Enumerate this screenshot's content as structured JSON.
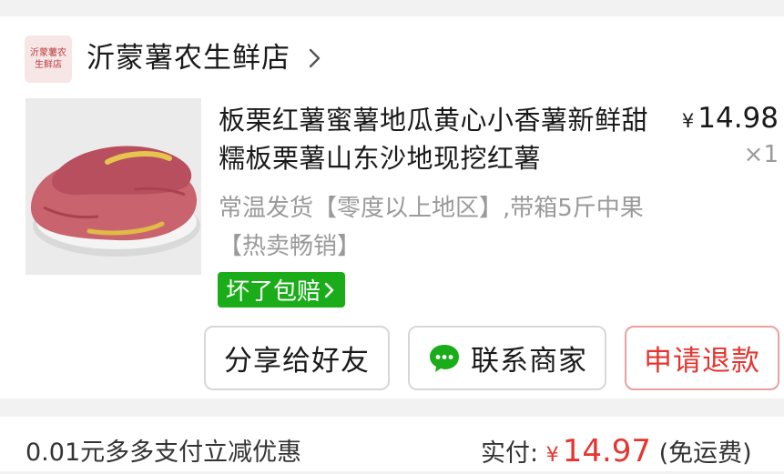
{
  "shop": {
    "logo_line1": "沂蒙薯农",
    "logo_line2": "生鲜店",
    "name": "沂蒙薯农生鲜店"
  },
  "product": {
    "title": "板栗红薯蜜薯地瓜黄心小香薯新鲜甜糯板栗薯山东沙地现挖红薯",
    "sku": "常温发货【零度以上地区】,带箱5斤中果【热卖畅销】",
    "currency": "¥",
    "price": "14.98",
    "quantity": "×1",
    "badge": "坏了包赔"
  },
  "actions": {
    "share": "分享给好友",
    "contact": "联系商家",
    "refund": "申请退款"
  },
  "summary": {
    "discount": "0.01元多多支付立减优惠",
    "paid_label": "实付:",
    "currency": "¥",
    "paid_amount": "14.97",
    "shipping": "(免运费)"
  },
  "colors": {
    "badge_green": "#1aad19",
    "refund_red": "#e5352f"
  }
}
